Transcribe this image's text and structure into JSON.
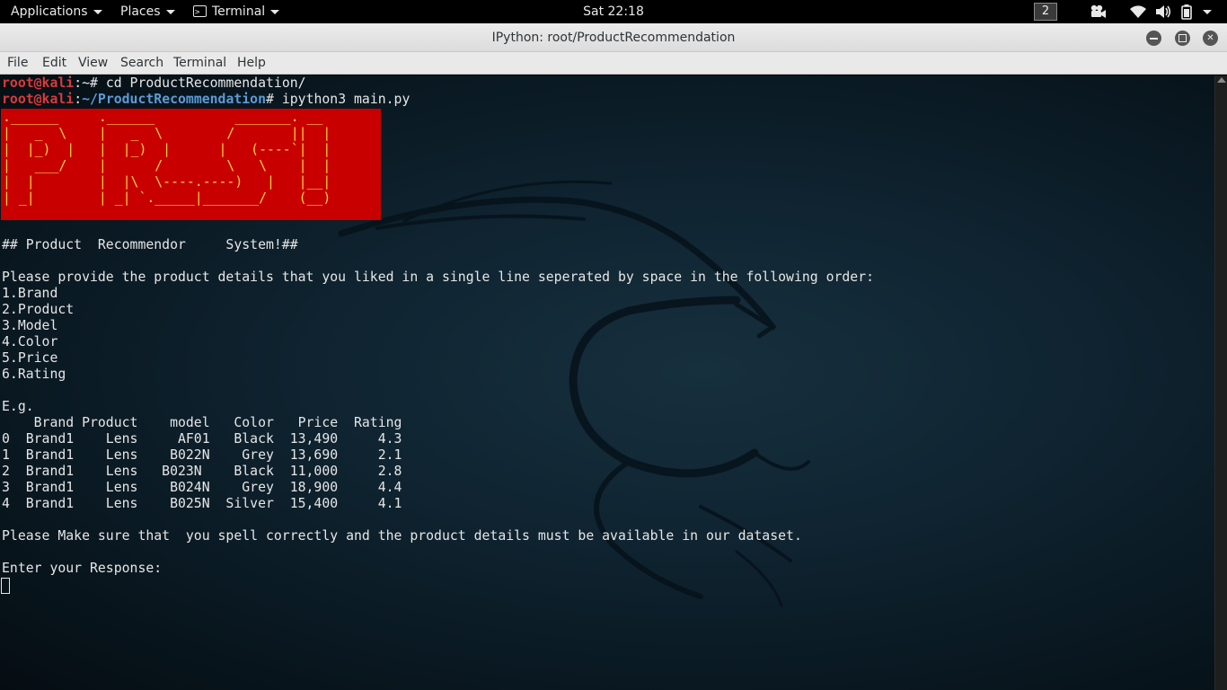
{
  "topbar": {
    "applications": "Applications",
    "places": "Places",
    "terminal": "Terminal",
    "clock": "Sat 22:18",
    "workspace": "2",
    "icons": [
      "video-icon",
      "wifi-icon",
      "volume-icon",
      "battery-icon",
      "power-menu-icon"
    ]
  },
  "window": {
    "title": "IPython: root/ProductRecommendation",
    "buttons": [
      "minimize",
      "maximize",
      "close"
    ]
  },
  "menubar": {
    "file": "File",
    "edit": "Edit",
    "view": "View",
    "search": "Search",
    "terminal": "Terminal",
    "help": "Help"
  },
  "terminal": {
    "prompt1": {
      "user": "root@kali",
      "sep": ":~# ",
      "cmd": "cd ProductRecommendation/"
    },
    "prompt2": {
      "user": "root@kali",
      "sep": ":",
      "path": "~/ProductRecommendation",
      "hash": "# ",
      "cmd": "ipython3 main.py"
    },
    "banner_art": ".______     .______          _______. __\n|   _  \\    |   _  \\        /       ||  |\n|  |_)  |   |  |_)  |      |   (----`|  |\n|   ___/    |      /        \\   \\    |  |\n|  |        |  |\\  \\----.----)   |   |__|\n| _|        | _| `._____|_______/    (__)",
    "heading": "## Product  Recommendor     System!##",
    "instruction": "Please provide the product details that you liked in a single line seperated by space in the following order:",
    "fields": [
      "1.Brand",
      "2.Product",
      "3.Model",
      "4.Color",
      "5.Price",
      "6.Rating"
    ],
    "eg": "E.g.",
    "table_header": "    Brand Product    model   Color   Price  Rating",
    "table_rows": [
      "0  Brand1    Lens     AF01   Black  13,490     4.3",
      "1  Brand1    Lens    B022N    Grey  13,690     2.1",
      "2  Brand1    Lens   B023N    Black  11,000     2.8",
      "3  Brand1    Lens    B024N    Grey  18,900     4.4",
      "4  Brand1    Lens    B025N  Silver  15,400     4.1"
    ],
    "note": "Please Make sure that  you spell correctly and the product details must be available in our dataset.",
    "response_prompt": "Enter your Response:"
  }
}
